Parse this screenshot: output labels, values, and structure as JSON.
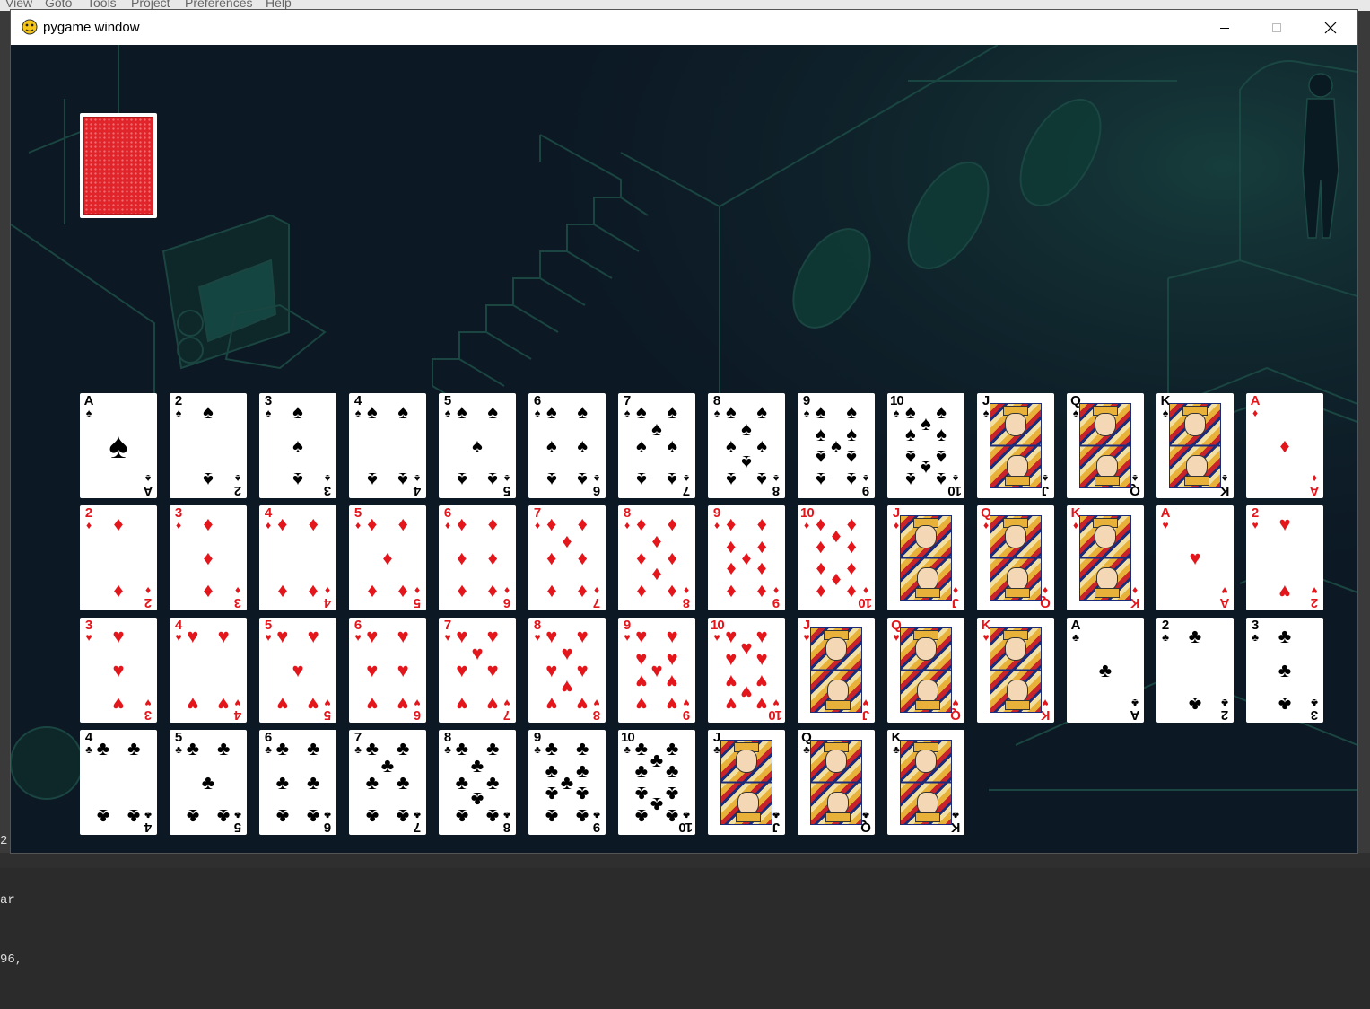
{
  "editor": {
    "menu": [
      "View",
      "Goto",
      "Tools",
      "Project",
      "Preferences",
      "Help"
    ],
    "left_lines": [
      "2.",
      "ar",
      "96,"
    ]
  },
  "window": {
    "title": "pygame window",
    "icon": "pygame-snake-icon",
    "buttons": [
      "minimize-icon",
      "maximize-icon",
      "close-icon"
    ]
  },
  "game": {
    "deck": {
      "state": "face-down",
      "color": "#e0242a"
    },
    "cards": [
      {
        "rank": "A",
        "suit": "spades"
      },
      {
        "rank": "2",
        "suit": "spades"
      },
      {
        "rank": "3",
        "suit": "spades"
      },
      {
        "rank": "4",
        "suit": "spades"
      },
      {
        "rank": "5",
        "suit": "spades"
      },
      {
        "rank": "6",
        "suit": "spades"
      },
      {
        "rank": "7",
        "suit": "spades"
      },
      {
        "rank": "8",
        "suit": "spades"
      },
      {
        "rank": "9",
        "suit": "spades"
      },
      {
        "rank": "10",
        "suit": "spades"
      },
      {
        "rank": "J",
        "suit": "spades"
      },
      {
        "rank": "Q",
        "suit": "spades"
      },
      {
        "rank": "K",
        "suit": "spades"
      },
      {
        "rank": "A",
        "suit": "diamonds"
      },
      {
        "rank": "2",
        "suit": "diamonds"
      },
      {
        "rank": "3",
        "suit": "diamonds"
      },
      {
        "rank": "4",
        "suit": "diamonds"
      },
      {
        "rank": "5",
        "suit": "diamonds"
      },
      {
        "rank": "6",
        "suit": "diamonds"
      },
      {
        "rank": "7",
        "suit": "diamonds"
      },
      {
        "rank": "8",
        "suit": "diamonds"
      },
      {
        "rank": "9",
        "suit": "diamonds"
      },
      {
        "rank": "10",
        "suit": "diamonds"
      },
      {
        "rank": "J",
        "suit": "diamonds"
      },
      {
        "rank": "Q",
        "suit": "diamonds"
      },
      {
        "rank": "K",
        "suit": "diamonds"
      },
      {
        "rank": "A",
        "suit": "hearts"
      },
      {
        "rank": "2",
        "suit": "hearts"
      },
      {
        "rank": "3",
        "suit": "hearts"
      },
      {
        "rank": "4",
        "suit": "hearts"
      },
      {
        "rank": "5",
        "suit": "hearts"
      },
      {
        "rank": "6",
        "suit": "hearts"
      },
      {
        "rank": "7",
        "suit": "hearts"
      },
      {
        "rank": "8",
        "suit": "hearts"
      },
      {
        "rank": "9",
        "suit": "hearts"
      },
      {
        "rank": "10",
        "suit": "hearts"
      },
      {
        "rank": "J",
        "suit": "hearts"
      },
      {
        "rank": "Q",
        "suit": "hearts"
      },
      {
        "rank": "K",
        "suit": "hearts"
      },
      {
        "rank": "A",
        "suit": "clubs"
      },
      {
        "rank": "2",
        "suit": "clubs"
      },
      {
        "rank": "3",
        "suit": "clubs"
      },
      {
        "rank": "4",
        "suit": "clubs"
      },
      {
        "rank": "5",
        "suit": "clubs"
      },
      {
        "rank": "6",
        "suit": "clubs"
      },
      {
        "rank": "7",
        "suit": "clubs"
      },
      {
        "rank": "8",
        "suit": "clubs"
      },
      {
        "rank": "9",
        "suit": "clubs"
      },
      {
        "rank": "10",
        "suit": "clubs"
      },
      {
        "rank": "J",
        "suit": "clubs"
      },
      {
        "rank": "Q",
        "suit": "clubs"
      },
      {
        "rank": "K",
        "suit": "clubs"
      }
    ],
    "suit_colors": {
      "spades": "#000000",
      "clubs": "#000000",
      "hearts": "#e3161c",
      "diamonds": "#e3161c"
    }
  }
}
